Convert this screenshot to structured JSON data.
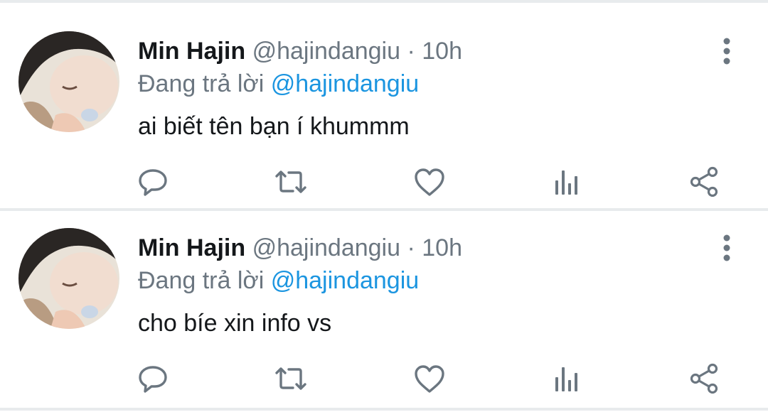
{
  "tweets": [
    {
      "name": "Min Hajin",
      "handle": "@hajindangiu",
      "separator": "·",
      "time": "10h",
      "reply_prefix": "Đang trả lời",
      "reply_to": "@hajindangiu",
      "text": "ai biết tên bạn í khummm",
      "icons": [
        "reply-icon",
        "retweet-icon",
        "like-icon",
        "analytics-icon",
        "share-icon",
        "more-icon"
      ]
    },
    {
      "name": "Min Hajin",
      "handle": "@hajindangiu",
      "separator": "·",
      "time": "10h",
      "reply_prefix": "Đang trả lời",
      "reply_to": "@hajindangiu",
      "text": "cho bíe xin info vs",
      "icons": [
        "reply-icon",
        "retweet-icon",
        "like-icon",
        "analytics-icon",
        "share-icon",
        "more-icon"
      ]
    }
  ],
  "colors": {
    "text": "#14171a",
    "secondary": "#6b7680",
    "link": "#1b95e0",
    "divider": "#e8ebed"
  }
}
